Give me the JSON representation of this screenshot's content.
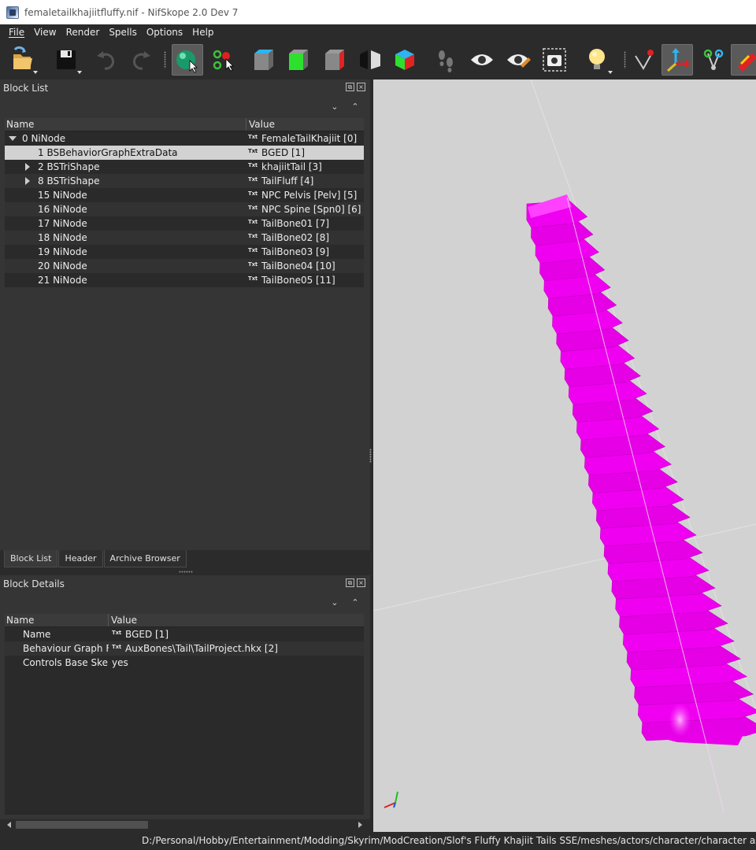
{
  "window": {
    "title": "femaletailkhajiitfluffy.nif - NifSkope 2.0 Dev 7"
  },
  "menu": {
    "file": "File",
    "view": "View",
    "render": "Render",
    "spells": "Spells",
    "options": "Options",
    "help": "Help"
  },
  "toolbar": {
    "buttons": [
      "open-icon",
      "save-icon",
      "undo-icon",
      "redo-icon",
      "select-object-icon",
      "select-vertex-icon",
      "view-top-icon",
      "view-front-icon",
      "view-side-icon",
      "view-flip-icon",
      "view-perspective-icon",
      "walk-mode-icon",
      "show-hidden-icon",
      "show-markers-icon",
      "screenshot-icon",
      "lighting-icon",
      "show-normals-icon",
      "show-axes-icon",
      "show-nodes-icon",
      "show-constraints-icon"
    ],
    "active": [
      "select-object-icon",
      "show-axes-icon"
    ]
  },
  "block_list": {
    "title": "Block List",
    "col_name": "Name",
    "col_value": "Value",
    "txt_icon": "Txt",
    "rows": [
      {
        "name": "0 NiNode",
        "value": "FemaleTailKhajiit [0]",
        "depth": 0,
        "expander": "expanded"
      },
      {
        "name": "1 BSBehaviorGraphExtraData",
        "value": "BGED [1]",
        "depth": 1,
        "expander": "none",
        "selected": true
      },
      {
        "name": "2 BSTriShape",
        "value": "khajiitTail [3]",
        "depth": 1,
        "expander": "collapsed"
      },
      {
        "name": "8 BSTriShape",
        "value": "TailFluff [4]",
        "depth": 1,
        "expander": "collapsed"
      },
      {
        "name": "15 NiNode",
        "value": "NPC Pelvis [Pelv] [5]",
        "depth": 1,
        "expander": "none"
      },
      {
        "name": "16 NiNode",
        "value": "NPC Spine [Spn0] [6]",
        "depth": 1,
        "expander": "none"
      },
      {
        "name": "17 NiNode",
        "value": "TailBone01 [7]",
        "depth": 1,
        "expander": "none"
      },
      {
        "name": "18 NiNode",
        "value": "TailBone02 [8]",
        "depth": 1,
        "expander": "none"
      },
      {
        "name": "19 NiNode",
        "value": "TailBone03 [9]",
        "depth": 1,
        "expander": "none"
      },
      {
        "name": "20 NiNode",
        "value": "TailBone04 [10]",
        "depth": 1,
        "expander": "none"
      },
      {
        "name": "21 NiNode",
        "value": "TailBone05 [11]",
        "depth": 1,
        "expander": "none"
      }
    ]
  },
  "tabs": [
    "Block List",
    "Header",
    "Archive Browser"
  ],
  "block_details": {
    "title": "Block Details",
    "col_name": "Name",
    "col_value": "Value",
    "rows": [
      {
        "name": "Name",
        "value": "BGED [1]",
        "txt": true
      },
      {
        "name": "Behaviour Graph F...",
        "value": "AuxBones\\Tail\\TailProject.hkx [2]",
        "txt": true
      },
      {
        "name": "Controls Base Skel...",
        "value": "yes",
        "txt": false
      }
    ]
  },
  "status": {
    "path": "D:/Personal/Hobby/Entertainment/Modding/Skyrim/ModCreation/Slof's Fluffy Khajiit Tails SSE/meshes/actors/character/character assets/femalet"
  },
  "colors": {
    "mesh": "#ff00ff",
    "viewport_bg": "#d2d2d2",
    "panel_bg": "#353535",
    "selection": "#d2d2d2"
  }
}
